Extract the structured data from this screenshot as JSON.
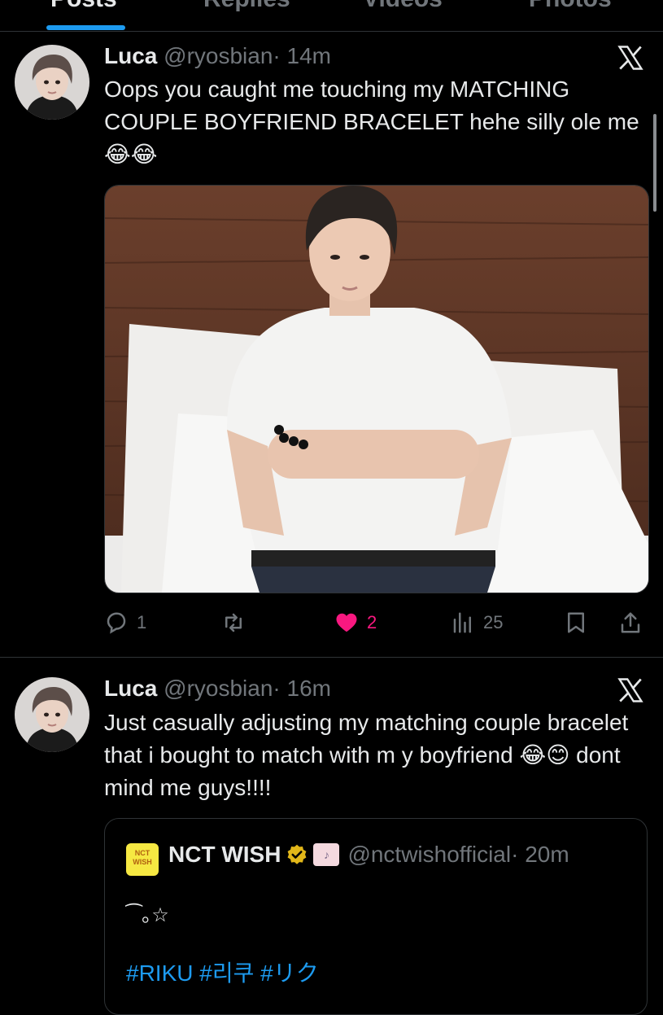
{
  "tabs": [
    "Posts",
    "Replies",
    "Videos",
    "Photos"
  ],
  "tweets": [
    {
      "name": "Luca",
      "handle": "@ryosbian",
      "time": "· 14m",
      "text": "Oops you caught me touching my MATCHING COUPLE BOYFRIEND BRACELET hehe silly ole me 😂😂",
      "stats": {
        "replies": "1",
        "reposts": "",
        "likes": "2",
        "views": "25"
      }
    },
    {
      "name": "Luca",
      "handle": "@ryosbian",
      "time": "· 16m",
      "text": "Just casually adjusting my matching couple bracelet that i bought to match with m y boyfriend 😂😊 dont mind me guys!!!!",
      "quote": {
        "logo_text": "NCT WISH",
        "name": "NCT WISH",
        "handle": "@nctwishofficial",
        "time": "· 20m",
        "text": "⁀｡☆",
        "tags": "#RIKU #리쿠 #リク"
      }
    }
  ],
  "colors": {
    "accent": "#1d9bf0",
    "like": "#f91880",
    "muted": "#71767b"
  },
  "icons": [
    "x-logo-icon",
    "reply-icon",
    "repost-icon",
    "heart-icon",
    "views-icon",
    "bookmark-icon",
    "share-icon",
    "verified-icon"
  ]
}
